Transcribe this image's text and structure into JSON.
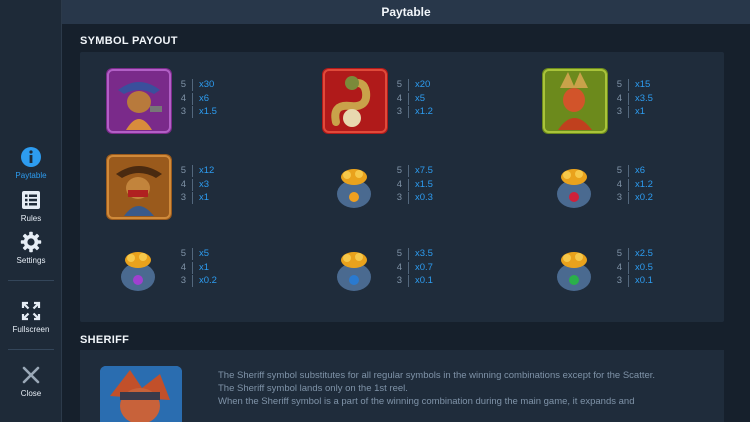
{
  "header": {
    "title": "Paytable"
  },
  "sidebar": {
    "items": [
      {
        "label": "Paytable",
        "icon": "info-icon",
        "active": true
      },
      {
        "label": "Rules",
        "icon": "list-icon"
      },
      {
        "label": "Settings",
        "icon": "gear-icon"
      },
      {
        "label": "Fullscreen",
        "icon": "fullscreen-icon"
      },
      {
        "label": "Close",
        "icon": "close-icon"
      }
    ]
  },
  "symbol_payout": {
    "title": "SYMBOL PAYOUT",
    "symbols": [
      {
        "name": "cowgirl-symbol",
        "pays": [
          {
            "count": "5",
            "mult": "x30"
          },
          {
            "count": "4",
            "mult": "x6"
          },
          {
            "count": "3",
            "mult": "x1.5"
          }
        ]
      },
      {
        "name": "snake-symbol",
        "pays": [
          {
            "count": "5",
            "mult": "x20"
          },
          {
            "count": "4",
            "mult": "x5"
          },
          {
            "count": "3",
            "mult": "x1.2"
          }
        ]
      },
      {
        "name": "chief-symbol",
        "pays": [
          {
            "count": "5",
            "mult": "x15"
          },
          {
            "count": "4",
            "mult": "x3.5"
          },
          {
            "count": "3",
            "mult": "x1"
          }
        ]
      },
      {
        "name": "outlaw-symbol",
        "pays": [
          {
            "count": "5",
            "mult": "x12"
          },
          {
            "count": "4",
            "mult": "x3"
          },
          {
            "count": "3",
            "mult": "x1"
          }
        ]
      },
      {
        "name": "bag-a-symbol",
        "pays": [
          {
            "count": "5",
            "mult": "x7.5"
          },
          {
            "count": "4",
            "mult": "x1.5"
          },
          {
            "count": "3",
            "mult": "x0.3"
          }
        ]
      },
      {
        "name": "bag-k-symbol",
        "pays": [
          {
            "count": "5",
            "mult": "x6"
          },
          {
            "count": "4",
            "mult": "x1.2"
          },
          {
            "count": "3",
            "mult": "x0.2"
          }
        ]
      },
      {
        "name": "bag-q-symbol",
        "pays": [
          {
            "count": "5",
            "mult": "x5"
          },
          {
            "count": "4",
            "mult": "x1"
          },
          {
            "count": "3",
            "mult": "x0.2"
          }
        ]
      },
      {
        "name": "bag-j-symbol",
        "pays": [
          {
            "count": "5",
            "mult": "x3.5"
          },
          {
            "count": "4",
            "mult": "x0.7"
          },
          {
            "count": "3",
            "mult": "x0.1"
          }
        ]
      },
      {
        "name": "bag-10-symbol",
        "pays": [
          {
            "count": "5",
            "mult": "x2.5"
          },
          {
            "count": "4",
            "mult": "x0.5"
          },
          {
            "count": "3",
            "mult": "x0.1"
          }
        ]
      }
    ]
  },
  "sheriff": {
    "title": "SHERIFF",
    "lines": [
      "The Sheriff symbol substitutes for all regular symbols in the winning combinations except for the Scatter.",
      "The Sheriff symbol lands only on the 1st reel.",
      "When the Sheriff symbol is a part of the winning combination during the main game, it expands and"
    ]
  },
  "colors": {
    "accent": "#2d9cf0",
    "panel": "#1f2c3b",
    "background": "#16202c"
  }
}
